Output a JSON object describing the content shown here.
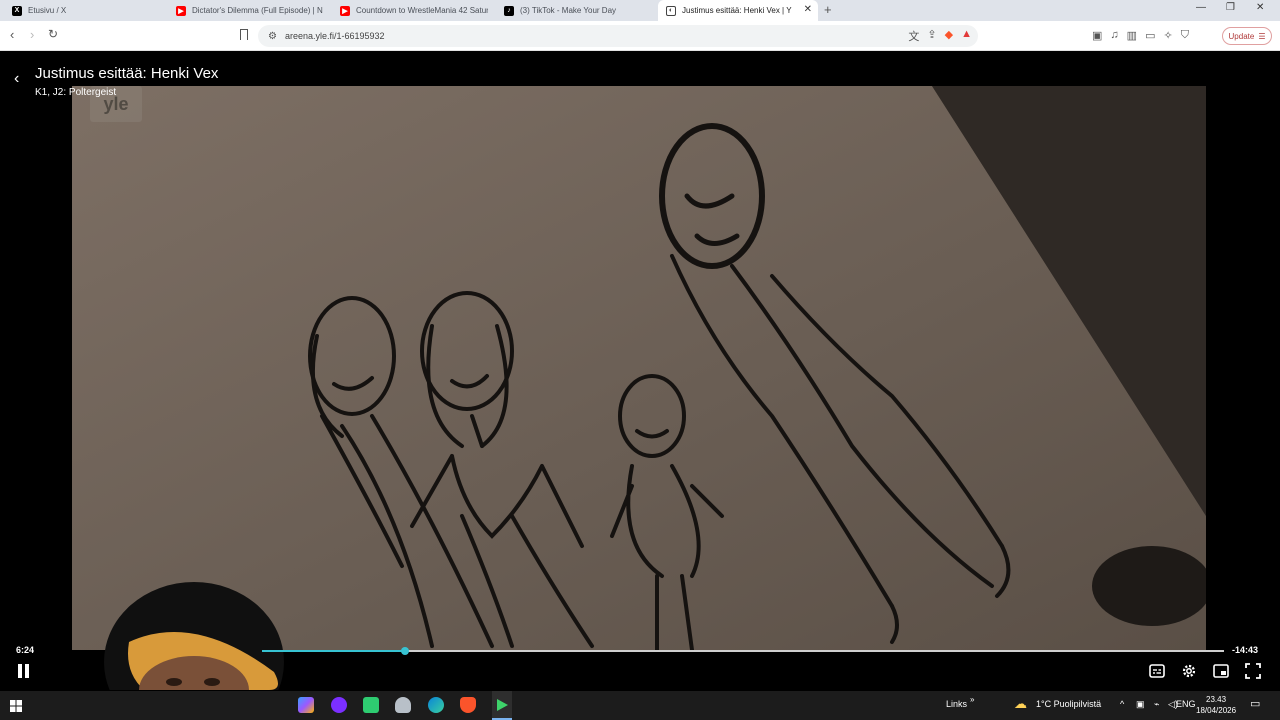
{
  "browser": {
    "tabs": [
      {
        "title": "Etusivu / X",
        "icon": "x-logo-icon",
        "color": "#000000"
      },
      {
        "title": "Dictator's Dilemma (Full Episode) | N",
        "icon": "youtube-icon",
        "color": "#ff0000"
      },
      {
        "title": "Countdown to WrestleMania 42 Satur",
        "icon": "youtube-icon",
        "color": "#ff0000"
      },
      {
        "title": "(3) TikTok - Make Your Day",
        "icon": "tiktok-icon",
        "color": "#000000"
      },
      {
        "title": "Justimus esittää: Henki Vex | Y",
        "icon": "yle-areena-icon",
        "color": "#444444",
        "active": true
      }
    ],
    "url": "areena.yle.fi/1-66195932",
    "update_label": "Update"
  },
  "player": {
    "title": "Justimus esittää: Henki Vex",
    "subtitle": "K1, J2: Poltergeist",
    "watermark": "yle",
    "elapsed": "6:24",
    "remaining": "-14:43",
    "progress_fraction": 0.149
  },
  "taskbar": {
    "links_label": "Links",
    "weather": "1°C  Puolipilvistä",
    "language": "ENG",
    "time": "23.43",
    "date": "18/04/2026"
  },
  "colors": {
    "progress": "#37c3d2",
    "brave": "#fb542b"
  }
}
